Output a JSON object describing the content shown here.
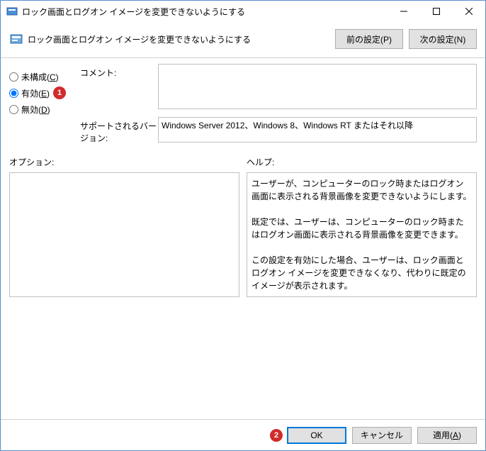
{
  "window": {
    "title": "ロック画面とログオン イメージを変更できないようにする"
  },
  "header": {
    "title": "ロック画面とログオン イメージを変更できないようにする",
    "prev": "前の設定(P)",
    "next": "次の設定(N)"
  },
  "radios": {
    "not_configured": "未構成(C)",
    "enabled": "有効(E)",
    "disabled": "無効(D)",
    "selected": "enabled"
  },
  "fields": {
    "comment_label": "コメント:",
    "comment_value": "",
    "supported_label": "サポートされるバージョン:",
    "supported_value": "Windows Server 2012、Windows 8、Windows RT またはそれ以降"
  },
  "columns": {
    "options_label": "オプション:",
    "help_label": "ヘルプ:",
    "help_text": "ユーザーが、コンピューターのロック時またはログオン画面に表示される背景画像を変更できないようにします。\n\n既定では、ユーザーは、コンピューターのロック時またはログオン画面に表示される背景画像を変更できます。\n\nこの設定を有効にした場合、ユーザーは、ロック画面とログオン イメージを変更できなくなり、代わりに既定のイメージが表示されます。"
  },
  "footer": {
    "ok": "OK",
    "cancel": "キャンセル",
    "apply": "適用(A)"
  },
  "markers": {
    "one": "1",
    "two": "2"
  }
}
